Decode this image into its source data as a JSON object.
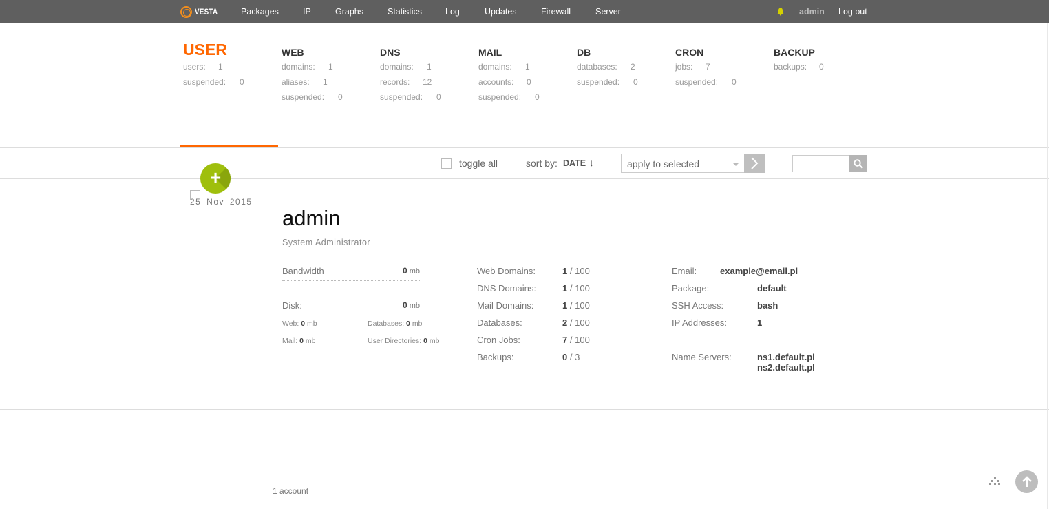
{
  "nav": {
    "logo": "VESTA",
    "items": [
      "Packages",
      "IP",
      "Graphs",
      "Statistics",
      "Log",
      "Updates",
      "Firewall",
      "Server"
    ],
    "user": "admin",
    "logout": "Log out",
    "colors": {
      "bar": "#5f5f5f",
      "logo": "#f38e1d",
      "bell": "#d4d000"
    }
  },
  "stats": [
    {
      "title": "USER",
      "rows": [
        {
          "label": "users:",
          "value": "1"
        },
        {
          "label": "suspended:",
          "value": "0"
        }
      ]
    },
    {
      "title": "WEB",
      "rows": [
        {
          "label": "domains:",
          "value": "1"
        },
        {
          "label": "aliases:",
          "value": "1"
        },
        {
          "label": "suspended:",
          "value": "0"
        }
      ]
    },
    {
      "title": "DNS",
      "rows": [
        {
          "label": "domains:",
          "value": "1"
        },
        {
          "label": "records:",
          "value": "12"
        },
        {
          "label": "suspended:",
          "value": "0"
        }
      ]
    },
    {
      "title": "MAIL",
      "rows": [
        {
          "label": "domains:",
          "value": "1"
        },
        {
          "label": "accounts:",
          "value": "0"
        },
        {
          "label": "suspended:",
          "value": "0"
        }
      ]
    },
    {
      "title": "DB",
      "rows": [
        {
          "label": "databases:",
          "value": "2"
        },
        {
          "label": "suspended:",
          "value": "0"
        }
      ]
    },
    {
      "title": "CRON",
      "rows": [
        {
          "label": "jobs:",
          "value": "7"
        },
        {
          "label": "suspended:",
          "value": "0"
        }
      ]
    },
    {
      "title": "BACKUP",
      "rows": [
        {
          "label": "backups:",
          "value": "0"
        }
      ]
    }
  ],
  "toolbar": {
    "toggle_all": "toggle all",
    "sort_by": "sort by:",
    "sort_value": "DATE",
    "sort_arrow": "↓",
    "apply_placeholder": "apply to selected",
    "search_value": "",
    "add_button": "+"
  },
  "record": {
    "date": "25 Nov 2015",
    "name": "admin",
    "role": "System Administrator",
    "bandwidth": {
      "label": "Bandwidth",
      "value": "0",
      "unit": "mb"
    },
    "disk": {
      "label": "Disk:",
      "value": "0",
      "unit": "mb"
    },
    "disk_breakdown": [
      {
        "label": "Web:",
        "value": "0",
        "unit": "mb"
      },
      {
        "label": "Databases:",
        "value": "0",
        "unit": "mb"
      },
      {
        "label": "Mail:",
        "value": "0",
        "unit": "mb"
      },
      {
        "label": "User Directories:",
        "value": "0",
        "unit": "mb"
      }
    ],
    "limits": [
      {
        "label": "Web Domains:",
        "used": "1",
        "sep": "/",
        "max": "100"
      },
      {
        "label": "DNS Domains:",
        "used": "1",
        "sep": "/",
        "max": "100"
      },
      {
        "label": "Mail Domains:",
        "used": "1",
        "sep": "/",
        "max": "100"
      },
      {
        "label": "Databases:",
        "used": "2",
        "sep": "/",
        "max": "100"
      },
      {
        "label": "Cron Jobs:",
        "used": "7",
        "sep": "/",
        "max": "100"
      },
      {
        "label": "Backups:",
        "used": "0",
        "sep": "/",
        "max": "3"
      }
    ],
    "info": {
      "email_label": "Email:",
      "email": "example@email.pl",
      "package_label": "Package:",
      "package": "default",
      "ssh_label": "SSH Access:",
      "ssh": "bash",
      "ip_label": "IP Addresses:",
      "ip": "1",
      "ns_label": "Name Servers:",
      "ns1": "ns1.default.pl",
      "ns2": "ns2.default.pl"
    }
  },
  "footer": {
    "count": "1 account"
  },
  "accent_color": "#ff6701"
}
